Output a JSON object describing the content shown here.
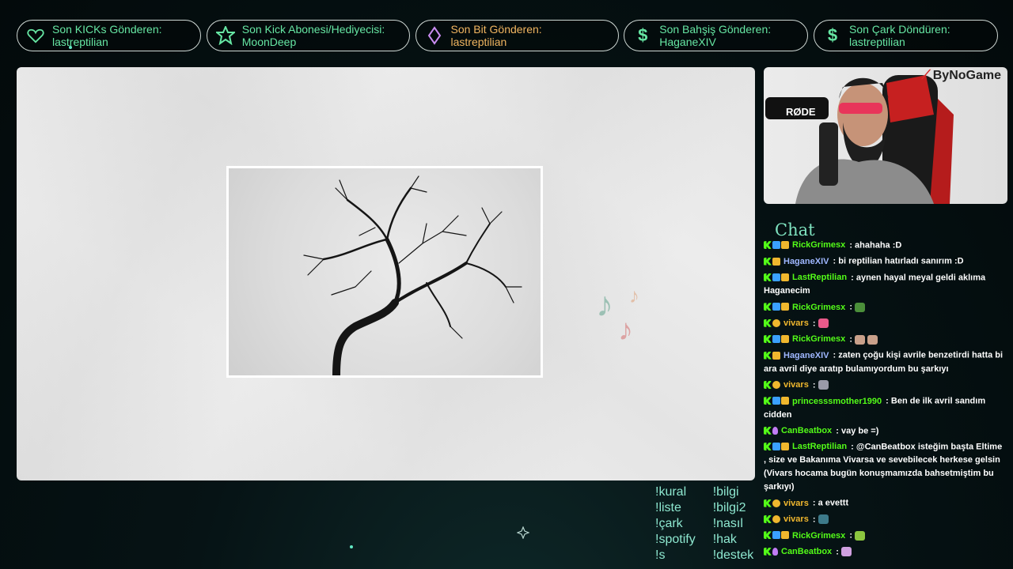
{
  "alerts": [
    {
      "label": "Son KICKs Gönderen:",
      "value": "lastreptilian",
      "icon": "heart-icon",
      "value_color": "green"
    },
    {
      "label": "Son Kick Abonesi/Hediyecisi:",
      "value": "MoonDeep",
      "icon": "star-icon",
      "value_color": "green"
    },
    {
      "label": "Son Bit Gönderen:",
      "value": "lastreptilian",
      "icon": "diamond-icon",
      "value_color": "gold"
    },
    {
      "label": "Son Bahşiş Gönderen:",
      "value": "HaganeXIV",
      "icon": "dollar-icon",
      "value_color": "green"
    },
    {
      "label": "Son Çark Döndüren:",
      "value": "lastreptilian",
      "icon": "dollar-icon",
      "value_color": "green"
    }
  ],
  "webcam": {
    "brand": "ByNoGame",
    "mic_label": "RØDE"
  },
  "chat": {
    "title": "Chat",
    "messages": [
      {
        "user": "RickGrimesx",
        "color": "#53fc18",
        "badges": [
          "kick",
          "sub",
          "crown"
        ],
        "text": " : ahahaha :D",
        "emoji": []
      },
      {
        "user": "HaganeXIV",
        "color": "#9fb7ff",
        "badges": [
          "kick",
          "crown"
        ],
        "text": " : bi reptilian hatırladı sanırım :D",
        "emoji": []
      },
      {
        "user": "LastReptilian",
        "color": "#53fc18",
        "badges": [
          "kick",
          "sub",
          "crown"
        ],
        "text": " : aynen hayal meyal geldi aklıma Haganecim",
        "emoji": []
      },
      {
        "user": "RickGrimesx",
        "color": "#53fc18",
        "badges": [
          "kick",
          "sub",
          "crown"
        ],
        "text": " :",
        "emoji": [
          "#4b8f3a"
        ]
      },
      {
        "user": "vivars",
        "color": "#f0b72e",
        "badges": [
          "kick",
          "og"
        ],
        "text": " :",
        "emoji": [
          "#e85a8a"
        ]
      },
      {
        "user": "RickGrimesx",
        "color": "#53fc18",
        "badges": [
          "kick",
          "sub",
          "crown"
        ],
        "text": " :",
        "emoji": [
          "#c9a08a",
          "#c9a08a"
        ]
      },
      {
        "user": "HaganeXIV",
        "color": "#9fb7ff",
        "badges": [
          "kick",
          "crown"
        ],
        "text": " : zaten çoğu kişi avrile benzetirdi hatta bi ara avril diye aratıp bulamıyordum bu şarkıyı",
        "emoji": []
      },
      {
        "user": "vivars",
        "color": "#f0b72e",
        "badges": [
          "kick",
          "og"
        ],
        "text": " :",
        "emoji": [
          "#9a9aa8"
        ]
      },
      {
        "user": "princesssmother1990",
        "color": "#53fc18",
        "badges": [
          "kick",
          "sub",
          "crown"
        ],
        "text": " : Ben de ilk avril sandım cidden",
        "emoji": []
      },
      {
        "user": "CanBeatbox",
        "color": "#53fc18",
        "badges": [
          "kick",
          "mic"
        ],
        "text": " : vay be =)",
        "emoji": []
      },
      {
        "user": "LastReptilian",
        "color": "#53fc18",
        "badges": [
          "kick",
          "sub",
          "crown"
        ],
        "text": " : @CanBeatbox isteğim başta Eltime , size ve Bakanıma Vivarsa ve sevebilecek herkese gelsin (Vivars hocama bugün konuşmamızda bahsetmiştim bu şarkıyı)",
        "emoji": []
      },
      {
        "user": "vivars",
        "color": "#f0b72e",
        "badges": [
          "kick",
          "og"
        ],
        "text": " : a evettt",
        "emoji": []
      },
      {
        "user": "vivars",
        "color": "#f0b72e",
        "badges": [
          "kick",
          "og"
        ],
        "text": " :",
        "emoji": [
          "#3d7a8a"
        ]
      },
      {
        "user": "RickGrimesx",
        "color": "#53fc18",
        "badges": [
          "kick",
          "sub",
          "crown"
        ],
        "text": " :",
        "emoji": [
          "#8cc63f"
        ]
      },
      {
        "user": "CanBeatbox",
        "color": "#53fc18",
        "badges": [
          "kick",
          "mic"
        ],
        "text": " :",
        "emoji": [
          "#d0a0e0"
        ]
      }
    ]
  },
  "commands": {
    "col1": [
      "!kural",
      "!liste",
      "!çark",
      "!spotify",
      "!s"
    ],
    "col2": [
      "!bilgi",
      "!bilgi2",
      "!nasıl",
      "!hak",
      "!destek"
    ]
  }
}
